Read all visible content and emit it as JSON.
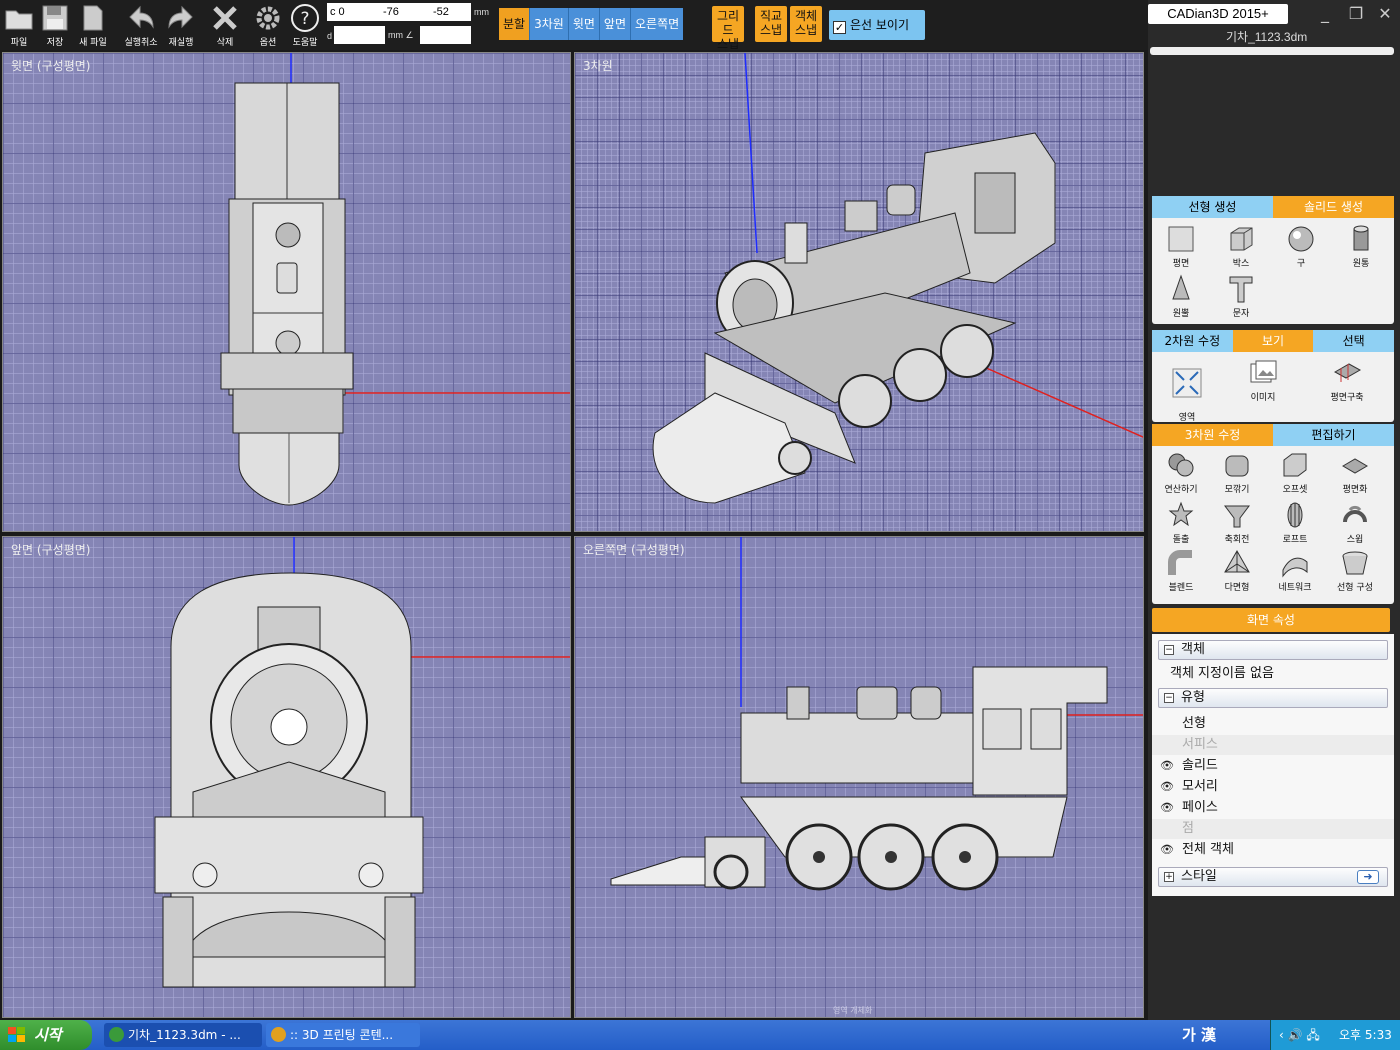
{
  "toolbar": {
    "tools": [
      {
        "label": "파일",
        "icon": "folder-icon"
      },
      {
        "label": "저장",
        "icon": "floppy-icon"
      },
      {
        "label": "새 파일",
        "icon": "new-file-icon"
      },
      {
        "label": "실행취소",
        "icon": "undo-icon"
      },
      {
        "label": "재실행",
        "icon": "redo-icon"
      },
      {
        "label": "삭제",
        "icon": "delete-x-icon"
      },
      {
        "label": "옵션",
        "icon": "gear-icon"
      },
      {
        "label": "도움말",
        "icon": "help-icon"
      }
    ],
    "coords": {
      "c": "c 0",
      "x": "-76",
      "y": "-52",
      "d_label": "d",
      "mm": "mm",
      "angle_label": "mm ∠"
    },
    "view_buttons": [
      "분할",
      "3차원",
      "윗면",
      "앞면",
      "오른쪽면"
    ],
    "active_view": "분할",
    "snap_buttons": [
      {
        "line1": "그리드",
        "line2": "스냅"
      },
      {
        "line1": "직교",
        "line2": "스냅"
      },
      {
        "line1": "객체",
        "line2": "스냅"
      }
    ],
    "hidden_lines": {
      "label": "은선 보이기",
      "checked": "✓"
    }
  },
  "app": {
    "title": "CADian3D 2015+",
    "file": "기차_1123.3dm",
    "minimize": "_",
    "maximize": "❐",
    "close": "✕"
  },
  "viewports": {
    "top": "윗면 (구성평면)",
    "perspective": "3차원",
    "front": "앞면 (구성평면)",
    "right": "오른쪽면 (구성평면)",
    "right_watermark": "영역 개체화"
  },
  "panel": {
    "create": {
      "tabs": [
        "선형 생성",
        "솔리드 생성"
      ],
      "active": "솔리드 생성",
      "items": [
        "평면",
        "박스",
        "구",
        "원통",
        "원뿔",
        "문자"
      ]
    },
    "edit2d": {
      "tabs": [
        "2차원 수정",
        "보기",
        "선택"
      ],
      "active": "보기",
      "items": [
        "영역\n개체화",
        "이미지",
        "평면구축"
      ]
    },
    "edit3d": {
      "tabs": [
        "3차원 수정",
        "편집하기"
      ],
      "active": "3차원 수정",
      "items": [
        "연산하기",
        "모깎기",
        "오프셋",
        "평면화",
        "돌출",
        "축회전",
        "로프트",
        "스윕",
        "블렌드",
        "다면형",
        "네트워크",
        "선형 구성"
      ]
    },
    "props": {
      "header": "화면 속성",
      "object_section": "객체",
      "object_name": "객체 지정이름 없음",
      "type_section": "유형",
      "types": [
        {
          "label": "선형",
          "visible": false,
          "enabled": true
        },
        {
          "label": "서피스",
          "visible": false,
          "enabled": false
        },
        {
          "label": "솔리드",
          "visible": true,
          "enabled": true
        },
        {
          "label": "모서리",
          "visible": true,
          "enabled": true
        },
        {
          "label": "페이스",
          "visible": true,
          "enabled": true
        },
        {
          "label": "점",
          "visible": false,
          "enabled": false
        },
        {
          "label": "전체 객체",
          "visible": true,
          "enabled": true
        }
      ],
      "style_section": "스타일"
    }
  },
  "taskbar": {
    "start": "시작",
    "tasks": [
      {
        "label": "기차_1123.3dm - ...",
        "icon_color": "#3a9a3a"
      },
      {
        "label": ":: 3D 프린팅 콘텐...",
        "icon_color": "#e0a020"
      }
    ],
    "ime": "가 漢",
    "clock": "오후 5:33"
  },
  "colors": {
    "accent": "#f5a623",
    "tab_blue": "#8fd0f3",
    "viewport": "#8585b5"
  }
}
